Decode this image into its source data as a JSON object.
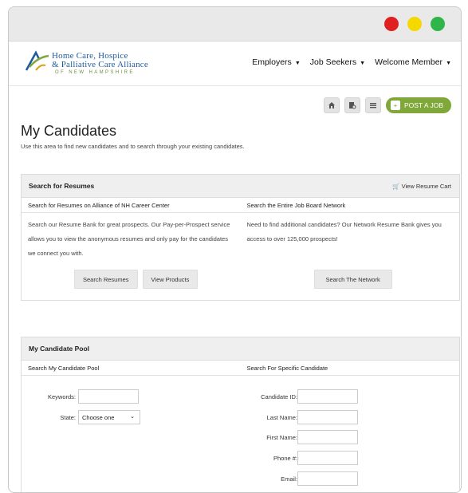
{
  "header": {
    "logo": {
      "line1": "Home Care, Hospice",
      "line2": "& Palliative Care Alliance",
      "line3": "OF NEW HAMPSHIRE"
    },
    "nav": [
      {
        "label": "Employers"
      },
      {
        "label": "Job Seekers"
      },
      {
        "label": "Welcome Member"
      }
    ]
  },
  "toolbar": {
    "icons": [
      "home-icon",
      "document-search-icon",
      "list-icon"
    ],
    "post_job_label": "POST A JOB"
  },
  "page": {
    "title": "My Candidates",
    "subtitle": "Use this area to find new candidates and to search through your existing candidates."
  },
  "resumes": {
    "title": "Search for Resumes",
    "cart_label": "View Resume Cart",
    "left": {
      "heading": "Search for Resumes on Alliance of NH Career Center",
      "text": "Search our Resume Bank for great prospects. Our Pay-per-Prospect service allows you to view the anonymous resumes and only pay for the candidates we connect you with.",
      "buttons": [
        "Search Resumes",
        "View Products"
      ]
    },
    "right": {
      "heading": "Search the Entire Job Board Network",
      "text": "Need to find additional candidates? Our Network Resume Bank gives you access to over 125,000 prospects!",
      "button": "Search The Network"
    }
  },
  "pool": {
    "title": "My Candidate Pool",
    "left_heading": "Search My Candidate Pool",
    "right_heading": "Search For Specific Candidate",
    "keywords_label": "Keywords:",
    "state_label": "State:",
    "state_value": "Choose one",
    "candidate_id_label": "Candidate ID:",
    "last_name_label": "Last Name:",
    "first_name_label": "First Name:",
    "phone_label": "Phone #:",
    "email_label": "Email:"
  },
  "colors": {
    "brand_green": "#7fa73a",
    "brand_blue": "#1e5a9c",
    "dot_red": "#e02020",
    "dot_yellow": "#f5d800",
    "dot_green": "#2fb54a"
  }
}
